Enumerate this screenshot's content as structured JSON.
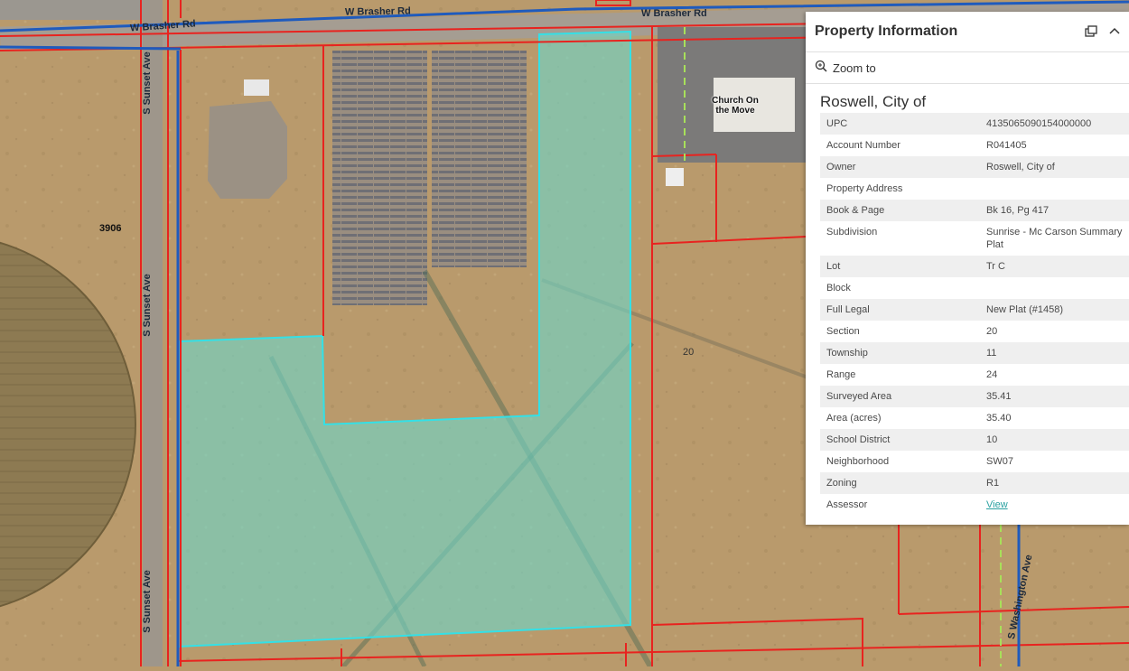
{
  "map": {
    "roads": {
      "brasher_1": "W Brasher Rd",
      "brasher_2": "W Brasher Rd",
      "brasher_3": "W Brasher Rd",
      "sunset_1": "S Sunset Ave",
      "sunset_2": "S Sunset Ave",
      "sunset_3": "S Sunset Ave",
      "washington": "S Washington Ave"
    },
    "place_label": "Church On the Move",
    "parcel_label_3906": "3906",
    "parcel_label_20": "20",
    "colors": {
      "parcel_line": "#e8231f",
      "road_line": "#1f5bbd",
      "selection_fill": "#6fd6c8",
      "selection_outline": "#34e0e6",
      "lot_line_dashed": "#a8e05a"
    }
  },
  "panel": {
    "title": "Property Information",
    "dock_icon": "dock-icon",
    "collapse_icon": "chevron-up-icon",
    "zoom_label": "Zoom to",
    "zoom_icon": "zoom-in-icon",
    "feature_title": "Roswell, City of",
    "attributes": [
      {
        "key": "UPC",
        "value": "4135065090154000000"
      },
      {
        "key": "Account Number",
        "value": "R041405"
      },
      {
        "key": "Owner",
        "value": "Roswell, City of"
      },
      {
        "key": "Property Address",
        "value": ""
      },
      {
        "key": "Book & Page",
        "value": "Bk 16, Pg 417"
      },
      {
        "key": "Subdivision",
        "value": "Sunrise - Mc Carson Summary Plat"
      },
      {
        "key": "Lot",
        "value": "Tr C"
      },
      {
        "key": "Block",
        "value": ""
      },
      {
        "key": "Full Legal",
        "value": "New Plat (#1458)"
      },
      {
        "key": "Section",
        "value": "20"
      },
      {
        "key": "Township",
        "value": "11"
      },
      {
        "key": "Range",
        "value": "24"
      },
      {
        "key": "Surveyed Area",
        "value": "35.41"
      },
      {
        "key": "Area (acres)",
        "value": "35.40"
      },
      {
        "key": "School District",
        "value": "10"
      },
      {
        "key": "Neighborhood",
        "value": "SW07"
      },
      {
        "key": "Zoning",
        "value": "R1"
      },
      {
        "key": "Assessor",
        "value": "View"
      }
    ]
  }
}
